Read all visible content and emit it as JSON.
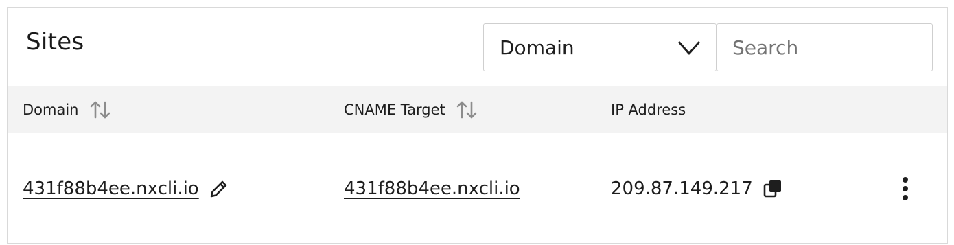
{
  "panel": {
    "title": "Sites"
  },
  "filter": {
    "selected": "Domain",
    "icon": "chevron-down-icon"
  },
  "search": {
    "placeholder": "Search",
    "value": ""
  },
  "table": {
    "columns": [
      {
        "label": "Domain",
        "sortable": true
      },
      {
        "label": "CNAME Target",
        "sortable": true
      },
      {
        "label": "IP Address",
        "sortable": false
      }
    ],
    "rows": [
      {
        "domain": "431f88b4ee.nxcli.io",
        "cname_target": "431f88b4ee.nxcli.io",
        "ip_address": "209.87.149.217"
      }
    ]
  },
  "icons": {
    "sort": "sort-arrows-icon",
    "edit": "pencil-icon",
    "copy": "copy-icon",
    "actions": "kebab-menu-icon"
  },
  "colors": {
    "text": "#1e1e1e",
    "header_bg": "#f3f3f3",
    "border": "#d9d9d9",
    "placeholder": "#737373"
  }
}
